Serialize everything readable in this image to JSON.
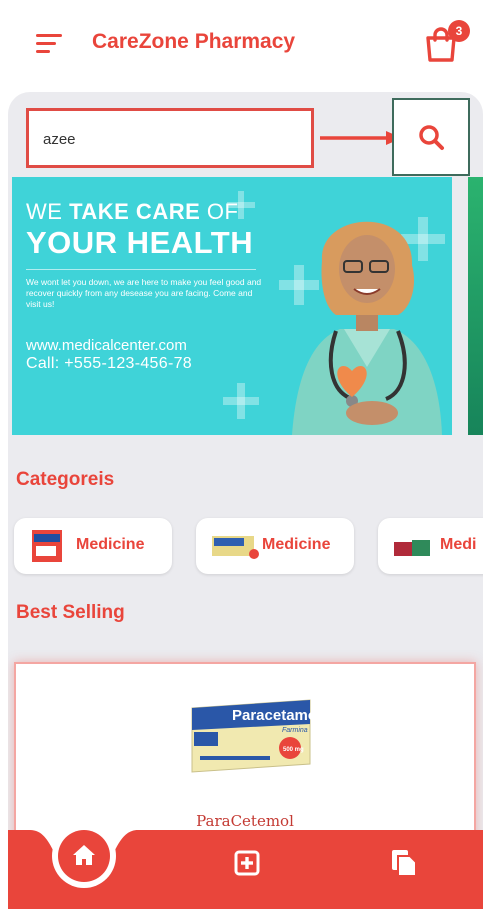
{
  "header": {
    "title": "CareZone Pharmacy",
    "cart_count": "3",
    "menu_icon": "menu-icon",
    "cart_icon": "shopping-bag-icon"
  },
  "search": {
    "value": "azee",
    "placeholder": "",
    "button_icon": "search-icon"
  },
  "banner": {
    "line1_light": "WE ",
    "line1_bold": "TAKE CARE",
    "line1_tail": " OF",
    "line2": "YOUR HEALTH",
    "body": "We wont let you down, we are here to make you feel good and recover quickly from any desease you are facing. Come and visit us!",
    "website": "www.medicalcenter.com",
    "phone": "Call: +555-123-456-78"
  },
  "sections": {
    "categories_title": "Categoreis",
    "best_selling_title": "Best Selling"
  },
  "categories": [
    {
      "label": "Medicine"
    },
    {
      "label": "Medicine"
    },
    {
      "label": "Medi"
    }
  ],
  "product": {
    "box_brand": "Paracetamol",
    "box_sub": "Farmina",
    "dose": "500 mg",
    "name": "ParaCetemol"
  },
  "bottom_nav": [
    {
      "icon": "home-icon"
    },
    {
      "icon": "plus-square-icon"
    },
    {
      "icon": "copy-icon"
    }
  ],
  "colors": {
    "accent": "#e9453b",
    "banner_bg": "#3fd3d8",
    "panel_bg": "#ebebef"
  }
}
